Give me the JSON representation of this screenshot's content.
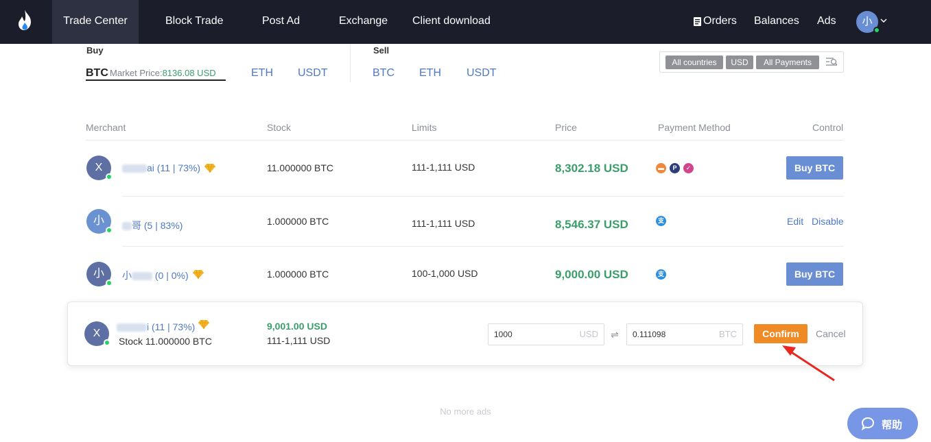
{
  "nav": {
    "items": [
      "Trade Center",
      "Block Trade",
      "Post Ad",
      "Exchange",
      "Client download"
    ],
    "right": {
      "orders": "Orders",
      "balances": "Balances",
      "ads": "Ads",
      "avatar": "小"
    }
  },
  "tabs": {
    "buy_label": "Buy",
    "sell_label": "Sell",
    "buy": [
      "BTC",
      "ETH",
      "USDT"
    ],
    "sell": [
      "BTC",
      "ETH",
      "USDT"
    ],
    "market_label": "Market Price:",
    "market_value": "8136.08 USD"
  },
  "filters": {
    "country": "All countries",
    "currency": "USD",
    "payments": "All Payments"
  },
  "table": {
    "headers": [
      "Merchant",
      "Stock",
      "Limits",
      "Price",
      "Payment Method",
      "Control"
    ],
    "rows": [
      {
        "avatar": "X",
        "merchant_tail": "ai",
        "stats": "(11 | 73%)",
        "stock": "11.000000 BTC",
        "limits": "111-1,111 USD",
        "price": "8,302.18 USD",
        "action": "Buy BTC"
      },
      {
        "avatar": "小",
        "merchant_tail": "哥",
        "stats": "(5 | 83%)",
        "stock": "1.000000 BTC",
        "limits": "111-1,111 USD",
        "price": "8,546.37 USD",
        "edit": "Edit",
        "disable": "Disable"
      },
      {
        "avatar": "小",
        "merchant_tail": "小",
        "stats": "(0 | 0%)",
        "stock": "1.000000 BTC",
        "limits": "100-1,000 USD",
        "price": "9,000.00 USD",
        "action": "Buy BTC"
      }
    ]
  },
  "order": {
    "avatar": "X",
    "merchant_tail": "i",
    "stats": "(11 | 73%)",
    "stock": "Stock 11.000000 BTC",
    "price": "9,001.00 USD",
    "limits": "111-1,111 USD",
    "fiat_value": "1000",
    "fiat_unit": "USD",
    "crypto_value": "0.111098",
    "crypto_unit": "BTC",
    "confirm": "Confirm",
    "cancel": "Cancel"
  },
  "footer": {
    "no_more": "No more ads",
    "help": "帮助"
  },
  "colors": {
    "nav_bg": "#1b1d2b",
    "accent_blue": "#6a8ed4",
    "price_green": "#3a9e6a",
    "confirm_orange": "#f08a24"
  },
  "icons": [
    "huobi-flame-logo",
    "orders-doc-icon",
    "chevron-down-icon",
    "search-filter-icon",
    "diamond-icon",
    "bank-card-icon",
    "paypal-icon",
    "pink-pay-icon",
    "alipay-icon",
    "swap-icon",
    "red-arrow-annotation",
    "chat-bubble-icon"
  ]
}
